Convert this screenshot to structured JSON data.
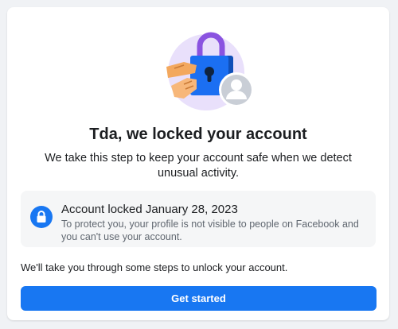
{
  "header": {
    "title": "Tda, we locked your account",
    "subtitle": "We take this step to keep your account safe when we detect unusual activity."
  },
  "illustration": {
    "icon": "padlock-with-hands-and-avatar-icon"
  },
  "lock_notice": {
    "icon": "lock-icon",
    "title": "Account locked January 28, 2023",
    "description": "To protect you, your profile is not visible to people on Facebook and you can't use your account."
  },
  "steps_text": "We'll take you through some steps to unlock your account.",
  "actions": {
    "primary_label": "Get started"
  },
  "colors": {
    "primary": "#1877f2",
    "background": "#f0f2f5",
    "card": "#ffffff",
    "info_box": "#f5f6f7",
    "secondary_text": "#606770"
  }
}
